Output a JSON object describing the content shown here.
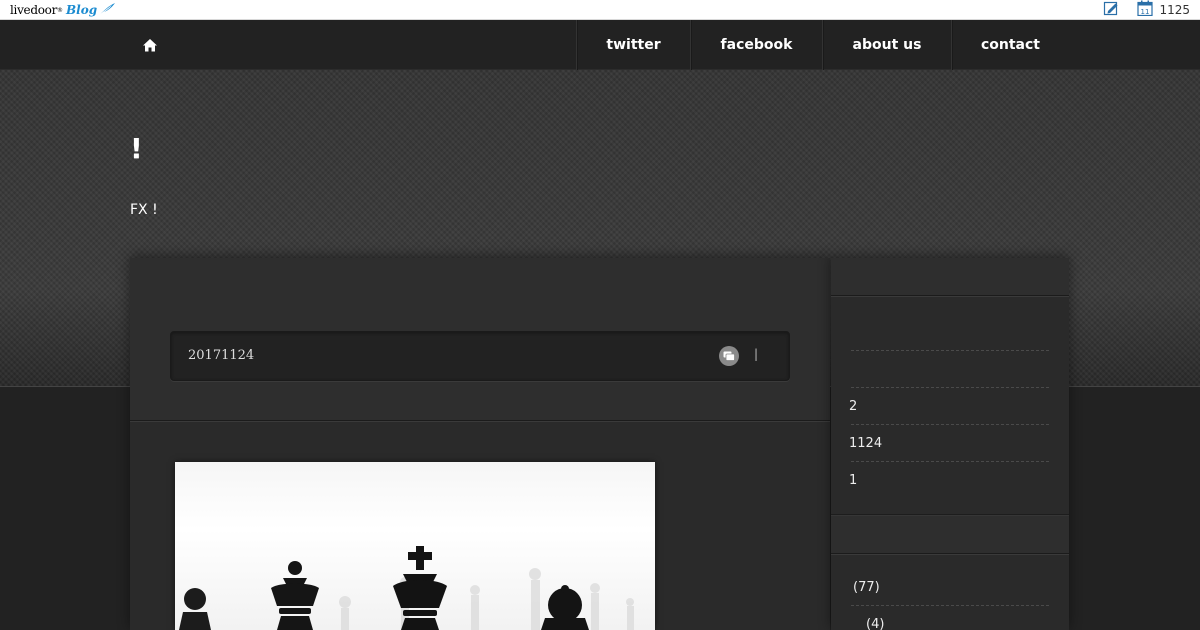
{
  "topbar": {
    "logo_brand": "livedoor",
    "logo_tm": "®",
    "logo_blog": "Blog",
    "icons": [
      "edit-icon",
      "calendar-icon"
    ],
    "calendar_day": "11",
    "date_text": "1125"
  },
  "nav": {
    "home_icon": "home-icon",
    "items": [
      {
        "label": "twitter"
      },
      {
        "label": "facebook"
      },
      {
        "label": "about us"
      },
      {
        "label": "contact"
      }
    ]
  },
  "header": {
    "title": "!",
    "description": "FX !"
  },
  "article": {
    "title": "",
    "date": "20171124",
    "comment_icon": "comment-icon",
    "separator": "|"
  },
  "sidebar": {
    "entries": [
      {
        "label": "2"
      },
      {
        "label": "1124"
      },
      {
        "label": "1"
      }
    ],
    "categories": [
      {
        "label": "(77)"
      },
      {
        "label": "(4)"
      }
    ]
  },
  "colors": {
    "page_bg": "#222222",
    "header_bg": "#3a3a3a",
    "panel_bg": "#2a2a2a",
    "text": "#ffffff",
    "blog_blue": "#1b8bd0"
  }
}
